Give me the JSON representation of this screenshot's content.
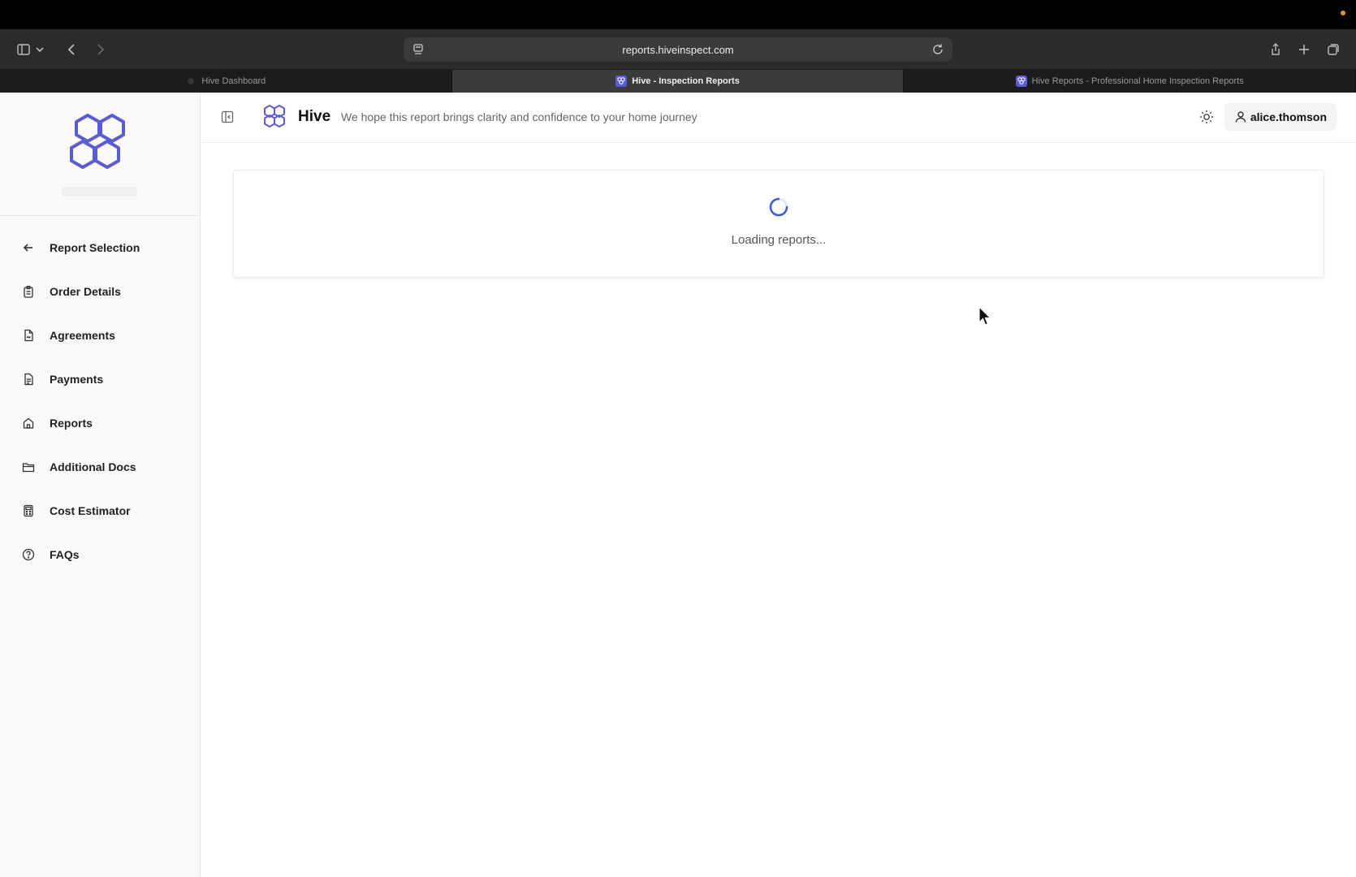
{
  "browser": {
    "url": "reports.hiveinspect.com",
    "tabs": [
      {
        "label": "Hive Dashboard",
        "active": false
      },
      {
        "label": "Hive - Inspection Reports",
        "active": true
      },
      {
        "label": "Hive Reports - Professional Home Inspection Reports",
        "active": false
      }
    ]
  },
  "header": {
    "brand": "Hive",
    "tagline": "We hope this report brings clarity and confidence to your home journey",
    "username": "alice.thomson"
  },
  "sidebar": {
    "items": [
      {
        "label": "Report Selection",
        "icon": "arrow-left-icon"
      },
      {
        "label": "Order Details",
        "icon": "clipboard-icon"
      },
      {
        "label": "Agreements",
        "icon": "file-signature-icon"
      },
      {
        "label": "Payments",
        "icon": "receipt-icon"
      },
      {
        "label": "Reports",
        "icon": "home-icon"
      },
      {
        "label": "Additional Docs",
        "icon": "folder-icon"
      },
      {
        "label": "Cost Estimator",
        "icon": "calculator-icon"
      },
      {
        "label": "FAQs",
        "icon": "help-circle-icon"
      }
    ]
  },
  "main": {
    "loading_text": "Loading reports..."
  },
  "colors": {
    "brand": "#5b5bd6",
    "spinner": "#3b5bd6"
  }
}
